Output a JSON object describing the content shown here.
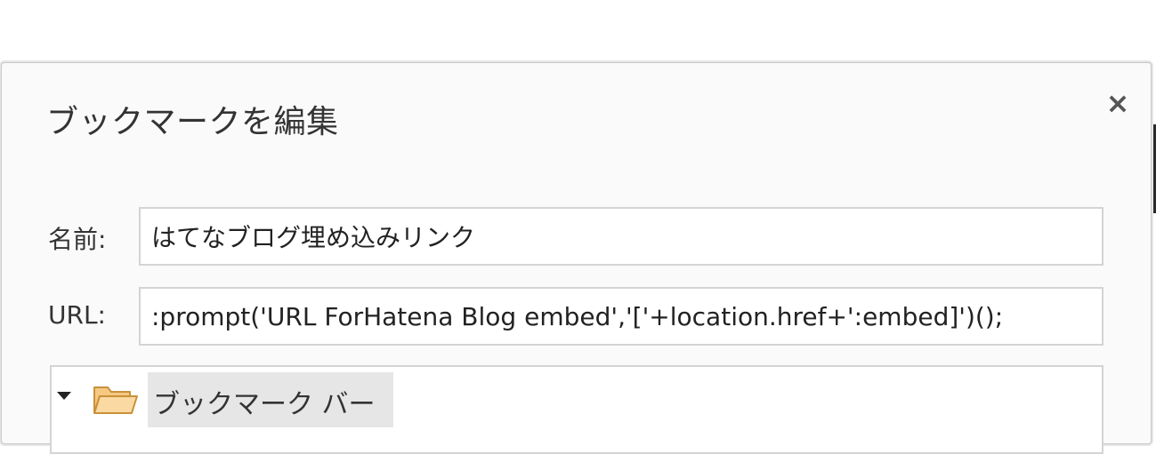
{
  "dialog": {
    "title": "ブックマークを編集",
    "close_label": "×"
  },
  "form": {
    "name_label": "名前:",
    "name_value": "はてなブログ埋め込みリンク",
    "url_label": "URL:",
    "url_value": ":prompt('URL ForHatena Blog embed','['+location.href+':embed]')();"
  },
  "folder_tree": {
    "items": [
      {
        "label": "ブックマーク バー",
        "icon": "folder-open-icon",
        "expanded": true,
        "selected": true
      }
    ]
  },
  "colors": {
    "dialog_background": "#fafafa",
    "selected_item": "#e6e6e6",
    "folder_fill": "#f6c882",
    "folder_stroke": "#c8913a"
  }
}
